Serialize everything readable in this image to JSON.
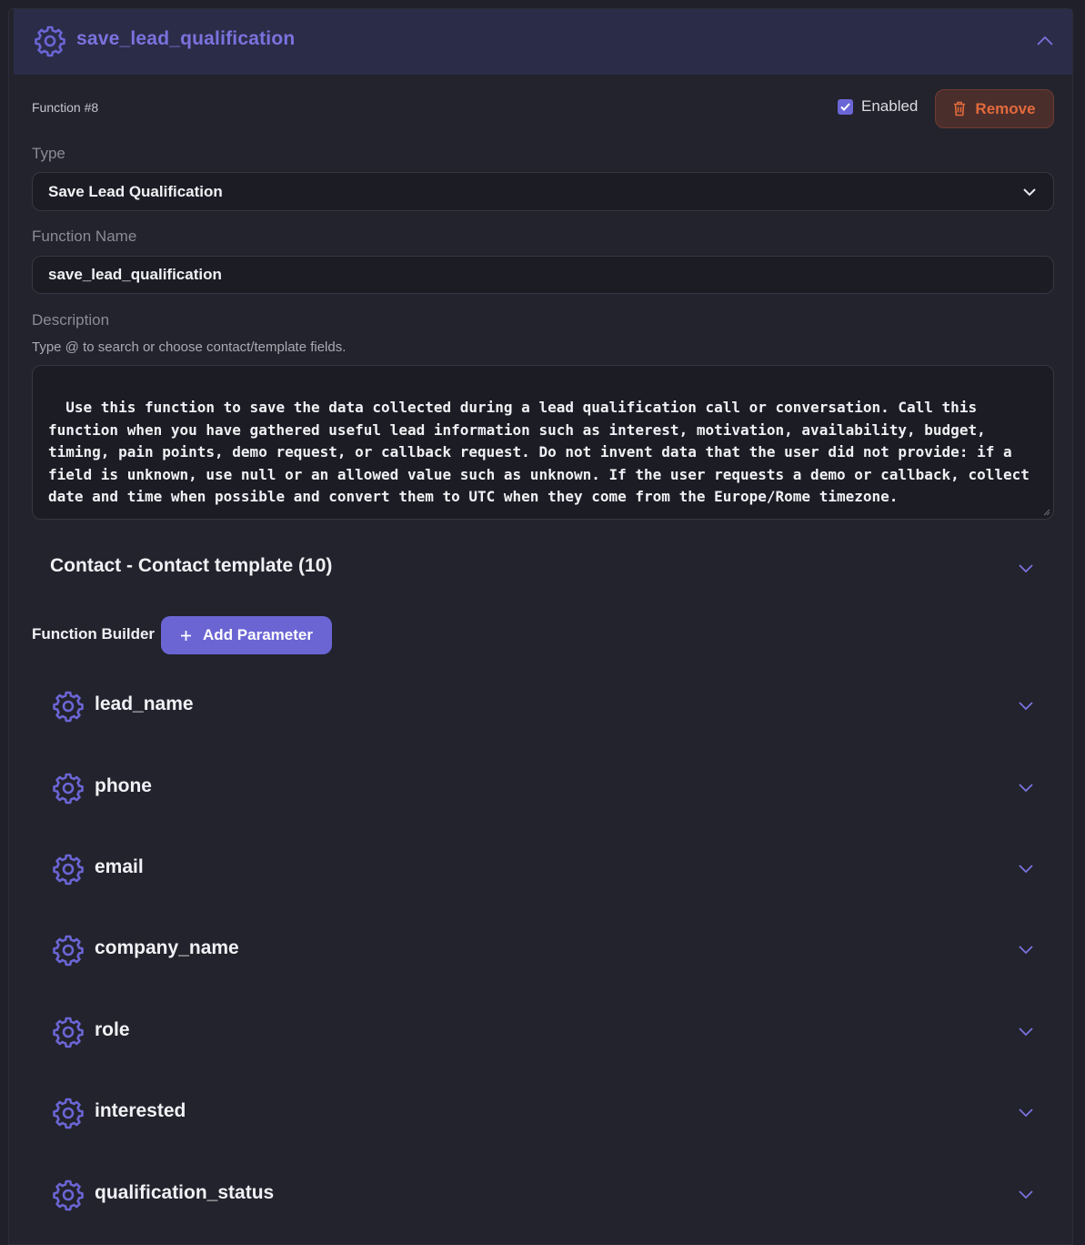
{
  "header": {
    "title": "save_lead_qualification",
    "icon": "gear-icon",
    "collapse_icon": "chevron-up-icon"
  },
  "function_number": "Function #8",
  "enabled": {
    "label": "Enabled",
    "checked": true
  },
  "remove_button": {
    "label": "Remove",
    "icon": "trash-icon"
  },
  "type": {
    "label": "Type",
    "value": "Save Lead Qualification"
  },
  "function_name": {
    "label": "Function Name",
    "value": "save_lead_qualification"
  },
  "description": {
    "label": "Description",
    "hint": "Type @ to search or choose contact/template fields.",
    "value": "Use this function to save the data collected during a lead qualification call or conversation. Call this function when you have gathered useful lead information such as interest, motivation, availability, budget, timing, pain points, demo request, or callback request. Do not invent data that the user did not provide: if a field is unknown, use null or an allowed value such as unknown. If the user requests a demo or callback, collect date and time when possible and convert them to UTC when they come from the Europe/Rome timezone."
  },
  "contact_section": {
    "title": "Contact - Contact template (10)"
  },
  "function_builder": {
    "label": "Function Builder",
    "add_button": "Add Parameter"
  },
  "parameters": [
    {
      "name": "lead_name"
    },
    {
      "name": "phone"
    },
    {
      "name": "email"
    },
    {
      "name": "company_name"
    },
    {
      "name": "role"
    },
    {
      "name": "interested"
    },
    {
      "name": "qualification_status"
    }
  ],
  "colors": {
    "accent": "#6b65d4",
    "header_bg": "#2b2c48",
    "danger": "#e26a3c",
    "background": "#1f2029"
  }
}
